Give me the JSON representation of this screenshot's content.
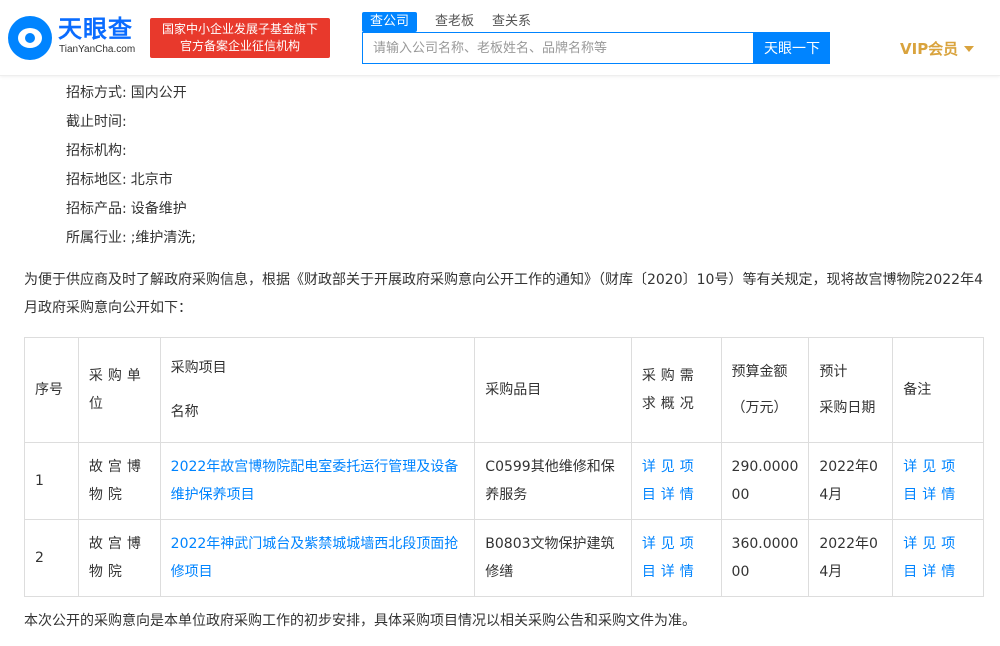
{
  "header": {
    "logo_cn": "天眼查",
    "logo_en": "TianYanCha.com",
    "badge_line1": "国家中小企业发展子基金旗下",
    "badge_line2": "官方备案企业征信机构",
    "tabs": [
      "查公司",
      "查老板",
      "查关系"
    ],
    "search_placeholder": "请输入公司名称、老板姓名、品牌名称等",
    "search_button": "天眼一下",
    "vip_label": "VIP会员"
  },
  "info": [
    {
      "key": "招标方式:",
      "value": "国内公开"
    },
    {
      "key": "截止时间:",
      "value": ""
    },
    {
      "key": "招标机构:",
      "value": ""
    },
    {
      "key": "招标地区:",
      "value": "北京市"
    },
    {
      "key": "招标产品:",
      "value": "设备维护"
    },
    {
      "key": "所属行业:",
      "value": ";维护清洗;"
    }
  ],
  "intro": "为便于供应商及时了解政府采购信息，根据《财政部关于开展政府采购意向公开工作的通知》（财库〔2020〕10号）等有关规定，现将故宫博物院2022年4月政府采购意向公开如下：",
  "table": {
    "headers": {
      "seq": "序号",
      "unit": "采购单位",
      "project_l1": "采购项目",
      "project_l2": "名称",
      "item": "采购品目",
      "demand": "采购需求概况",
      "budget_l1": "预算金额",
      "budget_l2": "（万元）",
      "date_l1": "预计",
      "date_l2": "采购日期",
      "note": "备注"
    },
    "rows": [
      {
        "seq": "1",
        "unit": "故宫博物院",
        "project": "2022年故宫博物院配电室委托运行管理及设备维护保养项目",
        "item": "C0599其他维修和保养服务",
        "demand": "详见项目详情",
        "budget_l1": "290.0000",
        "budget_l2": "00",
        "date_l1": "2022年0",
        "date_l2": "4月",
        "note": "详见项目详情"
      },
      {
        "seq": "2",
        "unit": "故宫博物院",
        "project": "2022年神武门城台及紫禁城城墙西北段顶面抢修项目",
        "item": "B0803文物保护建筑修缮",
        "demand": "详见项目详情",
        "budget_l1": "360.0000",
        "budget_l2": "00",
        "date_l1": "2022年0",
        "date_l2": "4月",
        "note": "详见项目详情"
      }
    ]
  },
  "footer_text": "本次公开的采购意向是本单位政府采购工作的初步安排，具体采购项目情况以相关采购公告和采购文件为准。",
  "colors": {
    "brand_blue": "#0084ff",
    "badge_red": "#e8392c",
    "vip_gold": "#d9a33d"
  }
}
